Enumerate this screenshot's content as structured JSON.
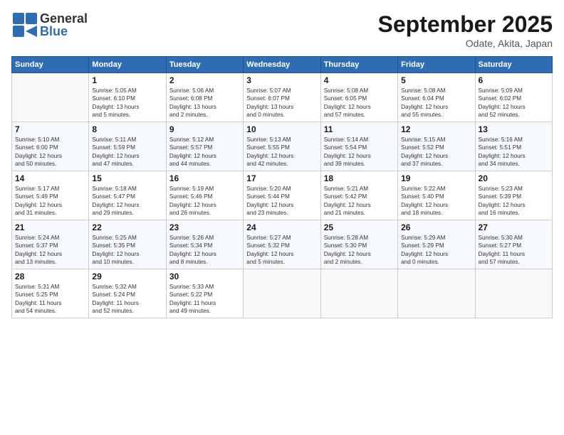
{
  "logo": {
    "general": "General",
    "blue": "Blue"
  },
  "header": {
    "title": "September 2025",
    "location": "Odate, Akita, Japan"
  },
  "days_of_week": [
    "Sunday",
    "Monday",
    "Tuesday",
    "Wednesday",
    "Thursday",
    "Friday",
    "Saturday"
  ],
  "weeks": [
    [
      {
        "day": "",
        "info": ""
      },
      {
        "day": "1",
        "info": "Sunrise: 5:05 AM\nSunset: 6:10 PM\nDaylight: 13 hours\nand 5 minutes."
      },
      {
        "day": "2",
        "info": "Sunrise: 5:06 AM\nSunset: 6:08 PM\nDaylight: 13 hours\nand 2 minutes."
      },
      {
        "day": "3",
        "info": "Sunrise: 5:07 AM\nSunset: 6:07 PM\nDaylight: 13 hours\nand 0 minutes."
      },
      {
        "day": "4",
        "info": "Sunrise: 5:08 AM\nSunset: 6:05 PM\nDaylight: 12 hours\nand 57 minutes."
      },
      {
        "day": "5",
        "info": "Sunrise: 5:08 AM\nSunset: 6:04 PM\nDaylight: 12 hours\nand 55 minutes."
      },
      {
        "day": "6",
        "info": "Sunrise: 5:09 AM\nSunset: 6:02 PM\nDaylight: 12 hours\nand 52 minutes."
      }
    ],
    [
      {
        "day": "7",
        "info": "Sunrise: 5:10 AM\nSunset: 6:00 PM\nDaylight: 12 hours\nand 50 minutes."
      },
      {
        "day": "8",
        "info": "Sunrise: 5:11 AM\nSunset: 5:59 PM\nDaylight: 12 hours\nand 47 minutes."
      },
      {
        "day": "9",
        "info": "Sunrise: 5:12 AM\nSunset: 5:57 PM\nDaylight: 12 hours\nand 44 minutes."
      },
      {
        "day": "10",
        "info": "Sunrise: 5:13 AM\nSunset: 5:55 PM\nDaylight: 12 hours\nand 42 minutes."
      },
      {
        "day": "11",
        "info": "Sunrise: 5:14 AM\nSunset: 5:54 PM\nDaylight: 12 hours\nand 39 minutes."
      },
      {
        "day": "12",
        "info": "Sunrise: 5:15 AM\nSunset: 5:52 PM\nDaylight: 12 hours\nand 37 minutes."
      },
      {
        "day": "13",
        "info": "Sunrise: 5:16 AM\nSunset: 5:51 PM\nDaylight: 12 hours\nand 34 minutes."
      }
    ],
    [
      {
        "day": "14",
        "info": "Sunrise: 5:17 AM\nSunset: 5:49 PM\nDaylight: 12 hours\nand 31 minutes."
      },
      {
        "day": "15",
        "info": "Sunrise: 5:18 AM\nSunset: 5:47 PM\nDaylight: 12 hours\nand 29 minutes."
      },
      {
        "day": "16",
        "info": "Sunrise: 5:19 AM\nSunset: 5:46 PM\nDaylight: 12 hours\nand 26 minutes."
      },
      {
        "day": "17",
        "info": "Sunrise: 5:20 AM\nSunset: 5:44 PM\nDaylight: 12 hours\nand 23 minutes."
      },
      {
        "day": "18",
        "info": "Sunrise: 5:21 AM\nSunset: 5:42 PM\nDaylight: 12 hours\nand 21 minutes."
      },
      {
        "day": "19",
        "info": "Sunrise: 5:22 AM\nSunset: 5:40 PM\nDaylight: 12 hours\nand 18 minutes."
      },
      {
        "day": "20",
        "info": "Sunrise: 5:23 AM\nSunset: 5:39 PM\nDaylight: 12 hours\nand 16 minutes."
      }
    ],
    [
      {
        "day": "21",
        "info": "Sunrise: 5:24 AM\nSunset: 5:37 PM\nDaylight: 12 hours\nand 13 minutes."
      },
      {
        "day": "22",
        "info": "Sunrise: 5:25 AM\nSunset: 5:35 PM\nDaylight: 12 hours\nand 10 minutes."
      },
      {
        "day": "23",
        "info": "Sunrise: 5:26 AM\nSunset: 5:34 PM\nDaylight: 12 hours\nand 8 minutes."
      },
      {
        "day": "24",
        "info": "Sunrise: 5:27 AM\nSunset: 5:32 PM\nDaylight: 12 hours\nand 5 minutes."
      },
      {
        "day": "25",
        "info": "Sunrise: 5:28 AM\nSunset: 5:30 PM\nDaylight: 12 hours\nand 2 minutes."
      },
      {
        "day": "26",
        "info": "Sunrise: 5:29 AM\nSunset: 5:29 PM\nDaylight: 12 hours\nand 0 minutes."
      },
      {
        "day": "27",
        "info": "Sunrise: 5:30 AM\nSunset: 5:27 PM\nDaylight: 11 hours\nand 57 minutes."
      }
    ],
    [
      {
        "day": "28",
        "info": "Sunrise: 5:31 AM\nSunset: 5:25 PM\nDaylight: 11 hours\nand 54 minutes."
      },
      {
        "day": "29",
        "info": "Sunrise: 5:32 AM\nSunset: 5:24 PM\nDaylight: 11 hours\nand 52 minutes."
      },
      {
        "day": "30",
        "info": "Sunrise: 5:33 AM\nSunset: 5:22 PM\nDaylight: 11 hours\nand 49 minutes."
      },
      {
        "day": "",
        "info": ""
      },
      {
        "day": "",
        "info": ""
      },
      {
        "day": "",
        "info": ""
      },
      {
        "day": "",
        "info": ""
      }
    ]
  ]
}
